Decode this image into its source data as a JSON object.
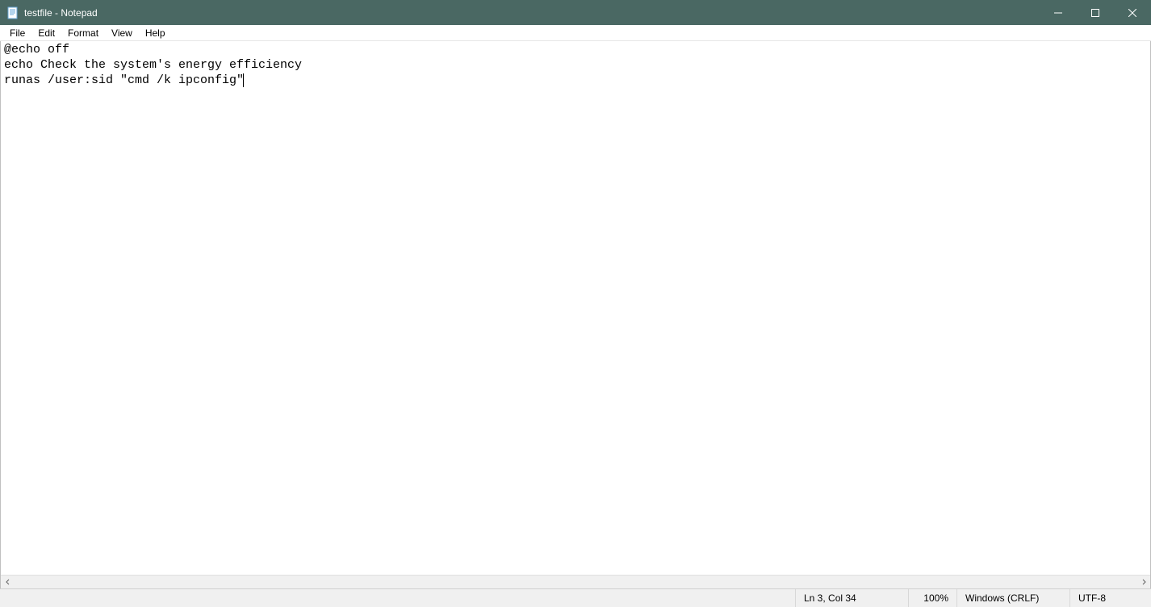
{
  "titlebar": {
    "title": "testfile - Notepad"
  },
  "menubar": {
    "items": [
      "File",
      "Edit",
      "Format",
      "View",
      "Help"
    ]
  },
  "editor": {
    "content": "@echo off\necho Check the system's energy efficiency\nrunas /user:sid \"cmd /k ipconfig\""
  },
  "statusbar": {
    "position": "Ln 3, Col 34",
    "zoom": "100%",
    "line_ending": "Windows (CRLF)",
    "encoding": "UTF-8"
  }
}
